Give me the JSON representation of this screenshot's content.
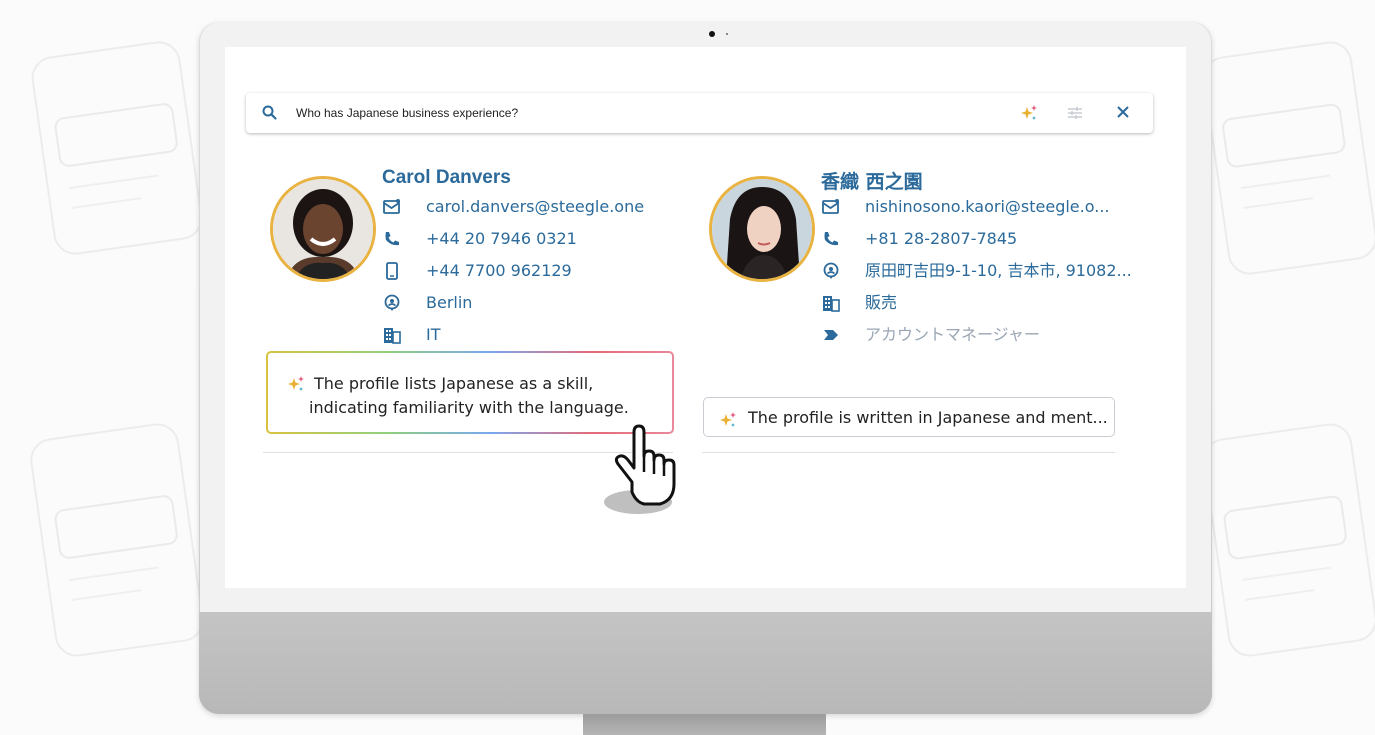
{
  "search": {
    "query": "Who has Japanese business experience?",
    "icons": [
      "search-icon",
      "ai-sparkle-icon",
      "tune-icon",
      "close-icon"
    ]
  },
  "contacts": [
    {
      "name": "Carol Danvers",
      "email": "carol.danvers@steegle.one",
      "phone": "+44 20 7946 0321",
      "mobile": "+44 7700 962129",
      "location": "Berlin",
      "department": "IT",
      "reason": [
        "The profile lists Japanese as a skill,",
        "indicating familiarity with the language."
      ]
    },
    {
      "name": "香織 西之園",
      "email": "nishinosono.kaori@steegle.o...",
      "phone": "+81 28-2807-7845",
      "location": "原田町吉田9-1-10, 吉本市, 91082...",
      "department": "販売",
      "title": "アカウントマネージャー",
      "reason": "The profile is written in Japanese and ment..."
    }
  ],
  "colors": {
    "accent": "#2b6a9a",
    "avatar_ring": "#e9b342",
    "muted": "#9aa6b4"
  }
}
